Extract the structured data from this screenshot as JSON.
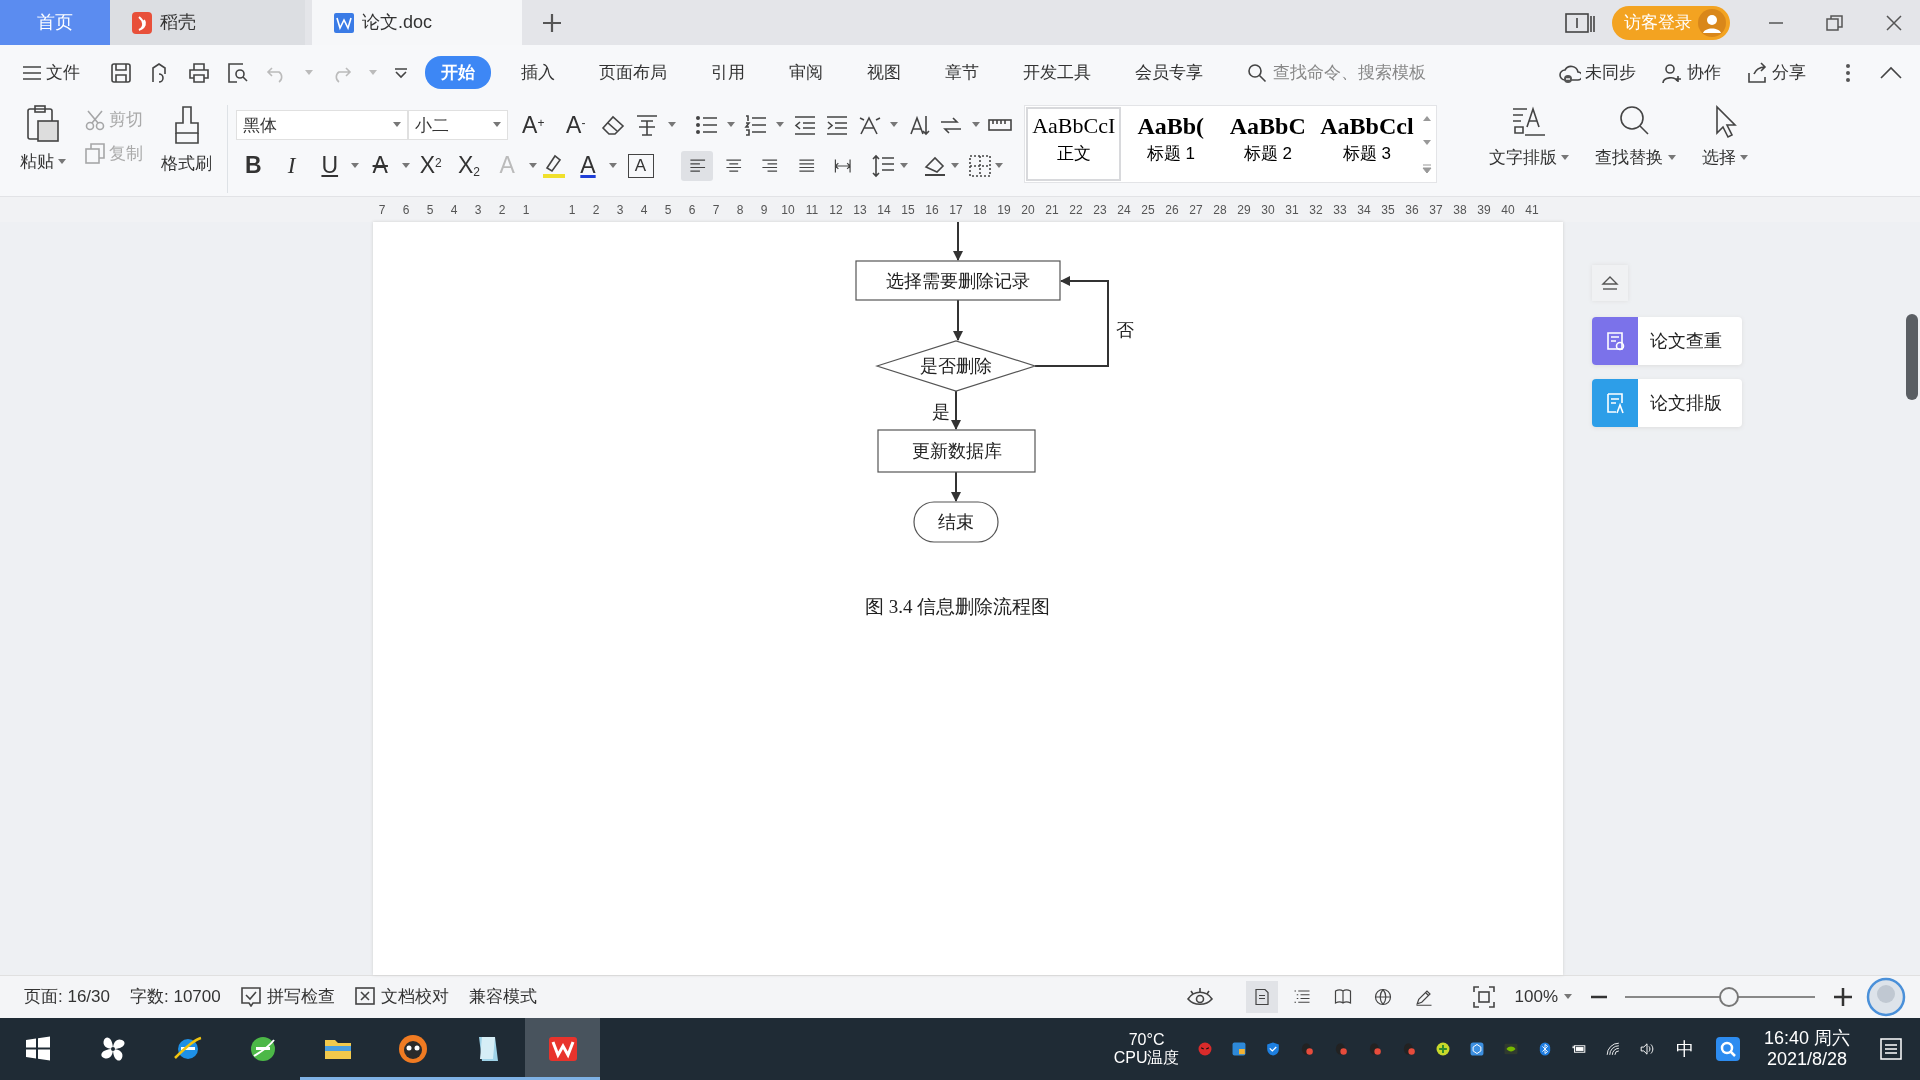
{
  "tab_bar": {
    "tabs": [
      {
        "label": "首页",
        "kind": "home",
        "selected": false
      },
      {
        "label": "稻壳",
        "kind": "docer",
        "selected": false
      },
      {
        "label": "论文.doc",
        "kind": "doc",
        "selected": true
      }
    ],
    "login": "访客登录"
  },
  "menu": {
    "file": "文件",
    "tabs": [
      {
        "label": "开始",
        "selected": true
      },
      {
        "label": "插入",
        "selected": false
      },
      {
        "label": "页面布局",
        "selected": false
      },
      {
        "label": "引用",
        "selected": false
      },
      {
        "label": "审阅",
        "selected": false
      },
      {
        "label": "视图",
        "selected": false
      },
      {
        "label": "章节",
        "selected": false
      },
      {
        "label": "开发工具",
        "selected": false
      },
      {
        "label": "会员专享",
        "selected": false
      }
    ],
    "search": {
      "placeholder": "查找命令、搜索模板"
    },
    "actions": [
      "未同步",
      "协作",
      "分享"
    ]
  },
  "ribbon": {
    "paste": "粘贴",
    "cut": {
      "label": "剪切",
      "disabled": true
    },
    "copy": {
      "label": "复制",
      "disabled": true
    },
    "format_painter": "格式刷",
    "font": {
      "value": "黑体"
    },
    "size": {
      "value": "小二"
    },
    "size_buttons": [
      "A$^{+}$",
      "A$^{-}$"
    ],
    "format_buttons": [
      {
        "label": "B",
        "kind": "bold"
      },
      {
        "label": "I",
        "kind": "italic"
      },
      {
        "label": "U",
        "kind": "underline"
      },
      {
        "label": "A",
        "kind": "strike"
      },
      {
        "label": "X$^{2}$",
        "kind": "sup"
      },
      {
        "label": "X$_{2}$",
        "kind": "sub"
      },
      {
        "label": "A",
        "kind": "effect"
      },
      {
        "label": "A",
        "kind": "color"
      },
      {
        "label": "A",
        "kind": "boxed"
      }
    ],
    "alignment": [
      {
        "selected": true
      },
      {
        "selected": false
      },
      {
        "selected": false
      },
      {
        "selected": false
      },
      {
        "selected": false
      }
    ],
    "styles": [
      {
        "sample": "AaBbCcI",
        "name": "正文",
        "selected": true
      },
      {
        "sample": "AaBb(",
        "name": "标题 1",
        "selected": false
      },
      {
        "sample": "AaBbC",
        "name": "标题 2",
        "selected": false
      },
      {
        "sample": "AaBbCcl",
        "name": "标题 3",
        "selected": false
      }
    ],
    "big_buttons": [
      "文字排版",
      "查找替换",
      "选择"
    ]
  },
  "ruler": {
    "marks": [
      "7",
      "6",
      "5",
      "4",
      "3",
      "2",
      "1",
      "1",
      "2",
      "3",
      "4",
      "5",
      "6",
      "7",
      "8",
      "9",
      "10",
      "11",
      "12",
      "13",
      "14",
      "15",
      "16",
      "17",
      "18",
      "19",
      "20",
      "21",
      "22",
      "23",
      "24",
      "25",
      "26",
      "27",
      "28",
      "29",
      "30",
      "31",
      "32",
      "33",
      "34",
      "35",
      "36",
      "37",
      "38",
      "39",
      "40",
      "41"
    ]
  },
  "document": {
    "flowchart": {
      "nodes": [
        {
          "kind": "process",
          "text": "选择需要删除记录"
        },
        {
          "kind": "decision",
          "text": "是否删除"
        },
        {
          "kind": "process",
          "text": "更新数据库"
        },
        {
          "kind": "terminal",
          "text": "结束"
        }
      ],
      "edge_labels": [
        {
          "kind": "no",
          "text": "否"
        },
        {
          "kind": "yes",
          "text": "是"
        }
      ]
    },
    "caption": "图 3.4  信息删除流程图"
  },
  "side_panel": {
    "buttons": [
      {
        "label": "论文查重",
        "color": "#7b72ea"
      },
      {
        "label": "论文排版",
        "color": "#2d9ee8"
      }
    ]
  },
  "status_bar": {
    "page": "页面: 16/30",
    "words": "字数: 10700",
    "checks": [
      "拼写检查",
      "文档校对"
    ],
    "mode": "兼容模式",
    "views": [
      {
        "selected": true
      },
      {
        "selected": false
      },
      {
        "selected": false
      },
      {
        "selected": false
      },
      {
        "selected": false
      }
    ],
    "zoom": "100%",
    "zoom_slider": {
      "level": 0.55
    }
  },
  "taskbar": {
    "apps": [
      {
        "kind": "start",
        "running": false,
        "selected": false
      },
      {
        "kind": "pinwheel",
        "running": false,
        "selected": false
      },
      {
        "kind": "ie",
        "running": false,
        "selected": false
      },
      {
        "kind": "browser",
        "running": false,
        "selected": false
      },
      {
        "kind": "folder",
        "running": true,
        "selected": false
      },
      {
        "kind": "mascot",
        "running": true,
        "selected": false
      },
      {
        "kind": "notepad",
        "running": true,
        "selected": false
      },
      {
        "kind": "wps",
        "running": true,
        "selected": true
      }
    ],
    "tray": {
      "temperature": "70°C",
      "sensor": "CPU温度",
      "input_method": "中",
      "time": "16:40 周六",
      "date": "2021/8/28"
    }
  }
}
